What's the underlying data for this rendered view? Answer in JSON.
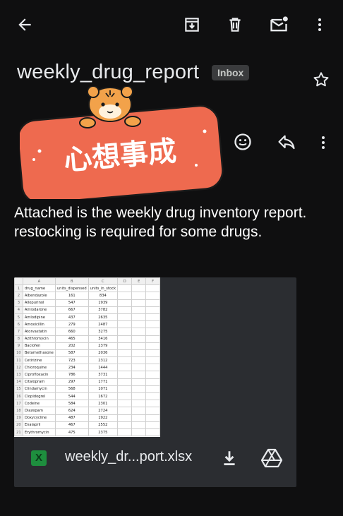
{
  "email": {
    "subject": "weekly_drug_report",
    "label": "Inbox",
    "body": "Attached is the weekly drug inventory report. restocking is required for some drugs."
  },
  "sticker": {
    "text": "心想事成"
  },
  "attachment": {
    "file_name": "weekly_dr...port.xlsx",
    "file_type_letter": "X",
    "preview": {
      "column_letters": [
        "A",
        "B",
        "C",
        "D",
        "E",
        "F"
      ],
      "headers": [
        "drug_name",
        "units_dispensed",
        "units_in_stock"
      ],
      "rows": [
        [
          "Albendazole",
          "161",
          "834"
        ],
        [
          "Allopurinol",
          "547",
          "1939"
        ],
        [
          "Amiodarone",
          "667",
          "3782"
        ],
        [
          "Amlodipine",
          "437",
          "2635"
        ],
        [
          "Amoxicillin",
          "279",
          "2487"
        ],
        [
          "Atorvastatin",
          "660",
          "3275"
        ],
        [
          "Azithromycin",
          "465",
          "3416"
        ],
        [
          "Baclofen",
          "202",
          "2379"
        ],
        [
          "Betamethasone",
          "587",
          "2036"
        ],
        [
          "Cetirizine",
          "723",
          "2312"
        ],
        [
          "Chloroquine",
          "234",
          "1444"
        ],
        [
          "Ciprofloxacin",
          "786",
          "3731"
        ],
        [
          "Citalopram",
          "297",
          "1771"
        ],
        [
          "Clindamycin",
          "568",
          "1071"
        ],
        [
          "Clopidogrel",
          "544",
          "1672"
        ],
        [
          "Codeine",
          "584",
          "2301"
        ],
        [
          "Diazepam",
          "624",
          "2724"
        ],
        [
          "Doxycycline",
          "487",
          "1922"
        ],
        [
          "Enalapril",
          "467",
          "2552"
        ],
        [
          "Erythromycin",
          "475",
          "2375"
        ]
      ]
    }
  }
}
